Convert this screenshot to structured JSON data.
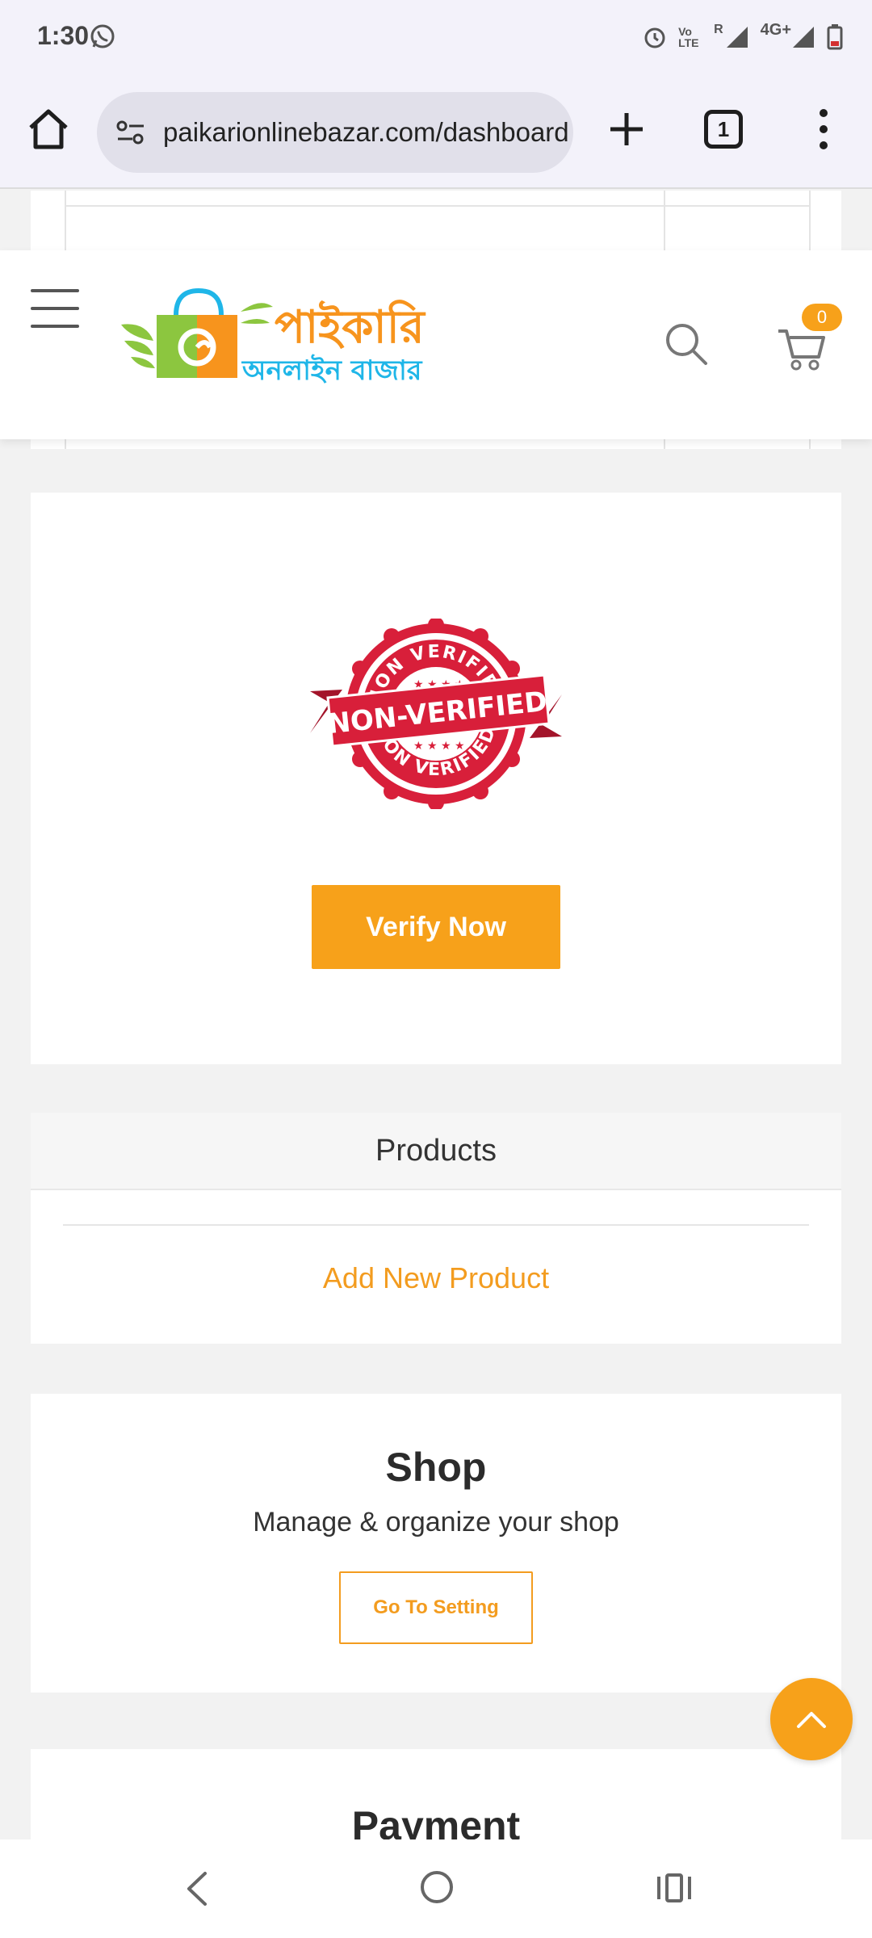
{
  "status_bar": {
    "time": "1:30",
    "network": "4G+",
    "network_prefix": "R",
    "volte": "Vo LTE",
    "icons": [
      "whatsapp-icon",
      "alarm-icon",
      "volte-icon",
      "signal-icon",
      "battery-icon"
    ]
  },
  "browser": {
    "url": "paikarionlinebazar.com/dashboard",
    "tab_count": "1",
    "icons": [
      "home-icon",
      "site-settings-icon",
      "plus-icon",
      "tabs-icon",
      "more-vert-icon"
    ]
  },
  "header": {
    "logo_line1": "পাইকারি",
    "logo_line2": "অনলাইন বাজার",
    "cart_count": "0",
    "icons": [
      "hamburger-icon",
      "search-icon",
      "cart-icon"
    ]
  },
  "verification": {
    "stamp_banner": "NON-VERIFIED",
    "stamp_ring_top": "NON VERIFIED",
    "stamp_ring_bottom": "NON VERIFIED",
    "button_label": "Verify Now"
  },
  "products": {
    "title": "Products",
    "add_link": "Add New Product"
  },
  "shop": {
    "title": "Shop",
    "subtitle": "Manage & organize your shop",
    "button_label": "Go To Setting"
  },
  "payment": {
    "title": "Payment"
  },
  "colors": {
    "accent": "#f7a11a",
    "link": "#f39c1f",
    "stamp_red": "#d81f3a",
    "page_bg": "#f2f2f2"
  }
}
